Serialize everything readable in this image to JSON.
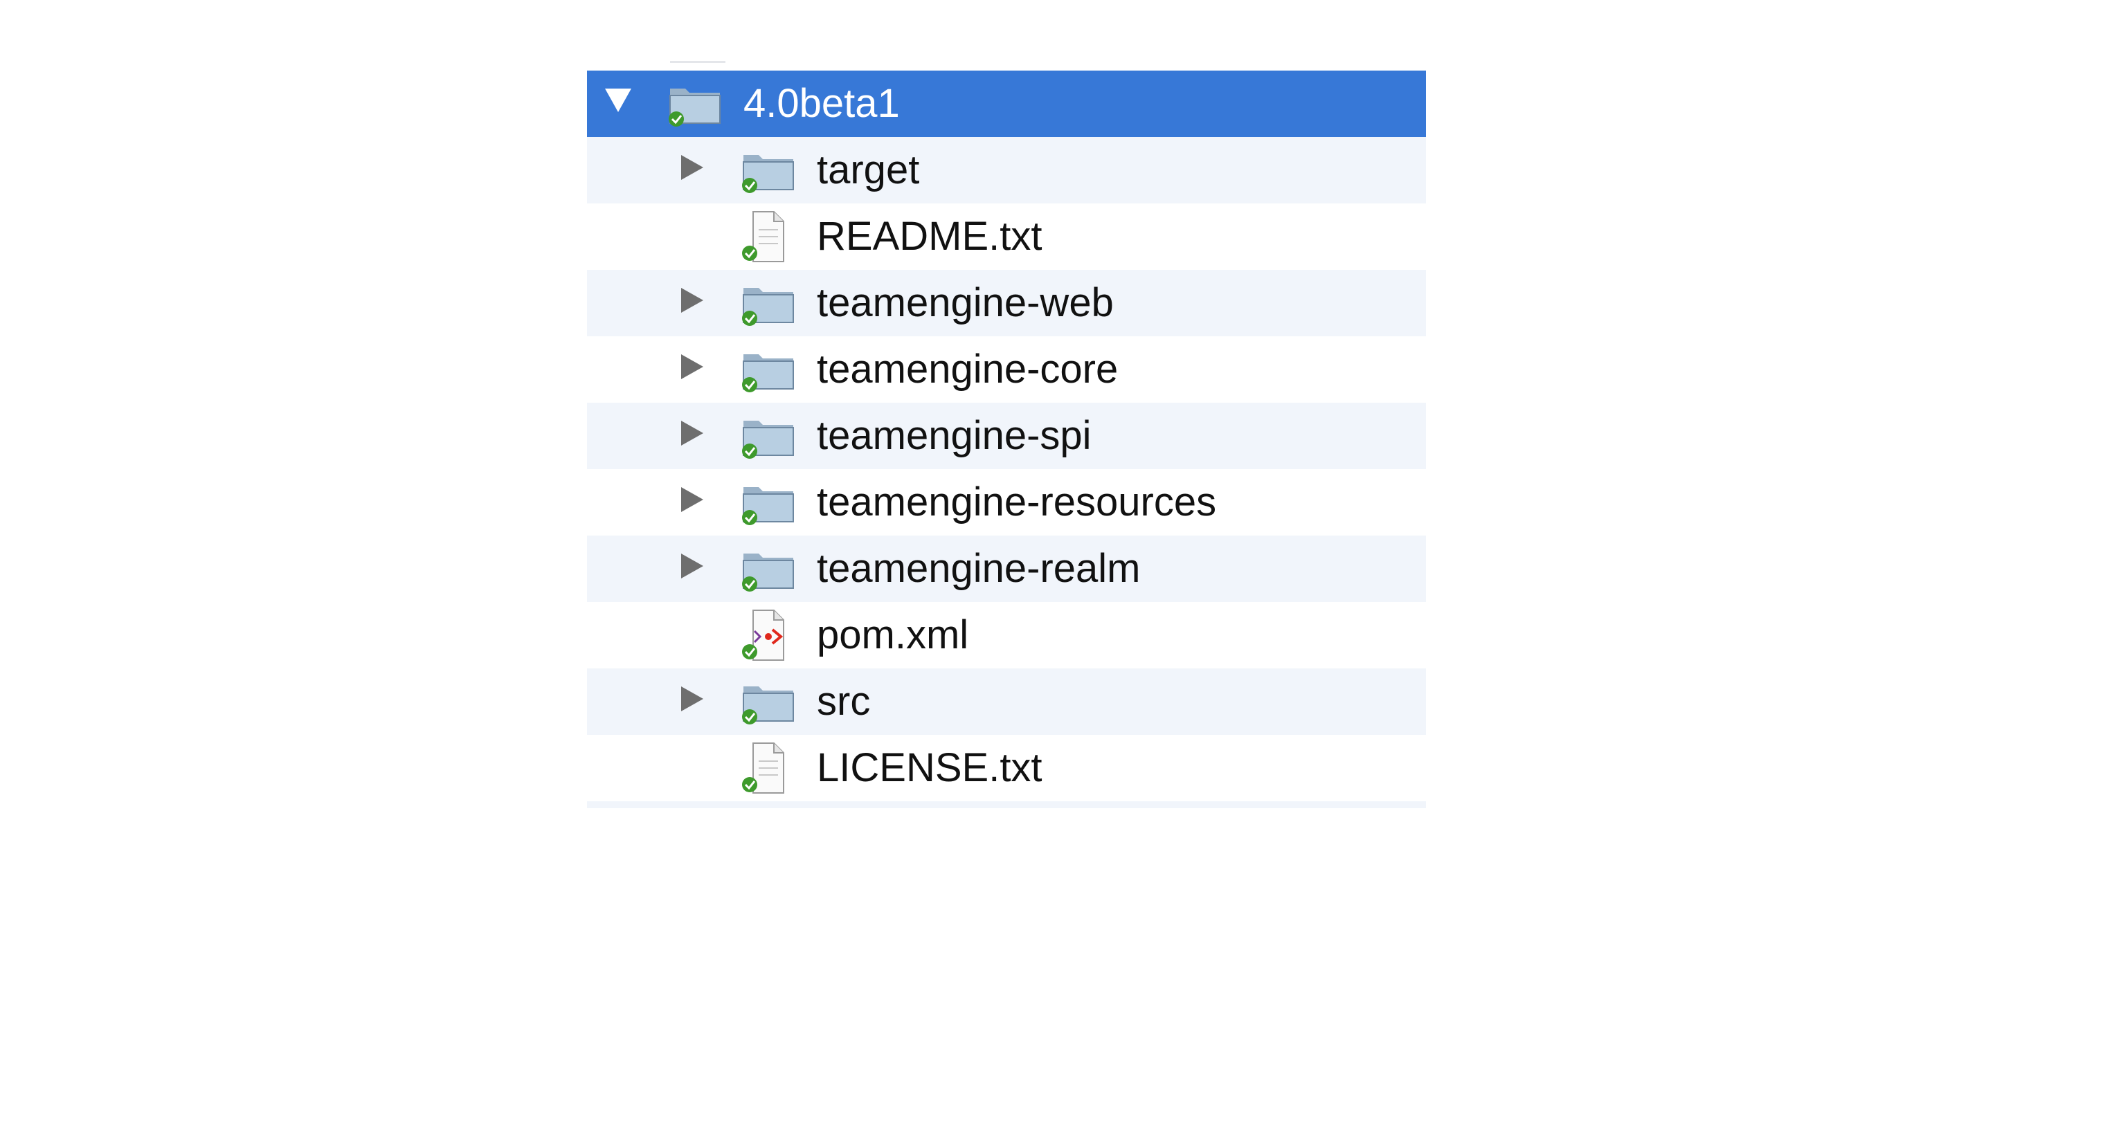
{
  "tree": {
    "root": {
      "label": "4.0beta1",
      "expanded": true,
      "icon": "project-folder-icon"
    },
    "children": [
      {
        "label": "target",
        "type": "folder",
        "icon": "folder-icon"
      },
      {
        "label": "README.txt",
        "type": "text-file",
        "icon": "text-file-icon"
      },
      {
        "label": "teamengine-web",
        "type": "folder",
        "icon": "folder-icon"
      },
      {
        "label": "teamengine-core",
        "type": "folder",
        "icon": "folder-icon"
      },
      {
        "label": "teamengine-spi",
        "type": "folder",
        "icon": "folder-icon"
      },
      {
        "label": "teamengine-resources",
        "type": "folder",
        "icon": "folder-icon"
      },
      {
        "label": "teamengine-realm",
        "type": "folder",
        "icon": "folder-icon"
      },
      {
        "label": "pom.xml",
        "type": "xml-file",
        "icon": "xml-file-icon"
      },
      {
        "label": "src",
        "type": "folder",
        "icon": "folder-icon"
      },
      {
        "label": "LICENSE.txt",
        "type": "text-file",
        "icon": "text-file-icon"
      }
    ]
  },
  "colors": {
    "selection": "#3778d7",
    "stripe": "#f1f5fb",
    "status_badge": "#3e9a2c"
  }
}
